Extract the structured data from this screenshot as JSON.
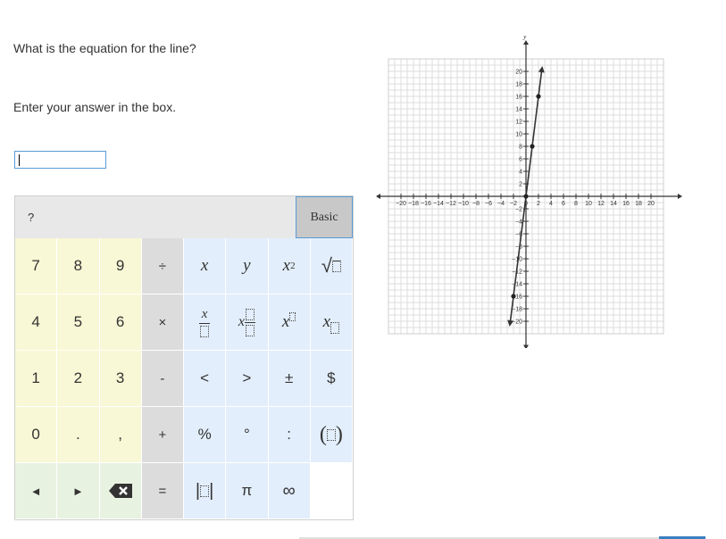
{
  "question": "What is the equation for the line?",
  "instruction": "Enter your answer in the box.",
  "answer_value": "",
  "keypad": {
    "help_label": "?",
    "tab_label": "Basic",
    "rows": [
      [
        "7",
        "8",
        "9",
        "÷"
      ],
      [
        "4",
        "5",
        "6",
        "×"
      ],
      [
        "1",
        "2",
        "3",
        "-"
      ],
      [
        "0",
        ".",
        ",",
        "+"
      ]
    ],
    "ops": {
      "equals": "=",
      "lt": "<",
      "gt": ">",
      "pm": "±",
      "dollar": "$",
      "percent": "%",
      "degree": "°",
      "colon": ":",
      "pi": "π",
      "infinity": "∞"
    },
    "vars": {
      "x": "x",
      "y": "y"
    },
    "nav": {
      "left": "◄",
      "right": "►"
    }
  },
  "chart_data": {
    "type": "line",
    "xlabel": "",
    "ylabel": "y",
    "xlim": [
      -20,
      20
    ],
    "ylim": [
      -20,
      20
    ],
    "grid": true,
    "x_ticks": [
      -20,
      -18,
      -16,
      -14,
      -12,
      -10,
      -8,
      -6,
      -4,
      -2,
      0,
      2,
      4,
      6,
      8,
      10,
      12,
      14,
      16,
      18,
      20
    ],
    "y_ticks": [
      -20,
      -18,
      -16,
      -14,
      -12,
      -10,
      -8,
      -6,
      -4,
      -2,
      2,
      4,
      6,
      8,
      10,
      12,
      14,
      16,
      18,
      20
    ],
    "series": [
      {
        "points": [
          [
            -2.5,
            -20
          ],
          [
            -2,
            -16
          ],
          [
            0,
            0
          ],
          [
            1,
            8
          ],
          [
            2,
            16
          ],
          [
            2.5,
            20
          ]
        ],
        "marked_points": [
          [
            -2,
            -16
          ],
          [
            0,
            0
          ],
          [
            1,
            8
          ],
          [
            2,
            16
          ]
        ]
      }
    ]
  }
}
